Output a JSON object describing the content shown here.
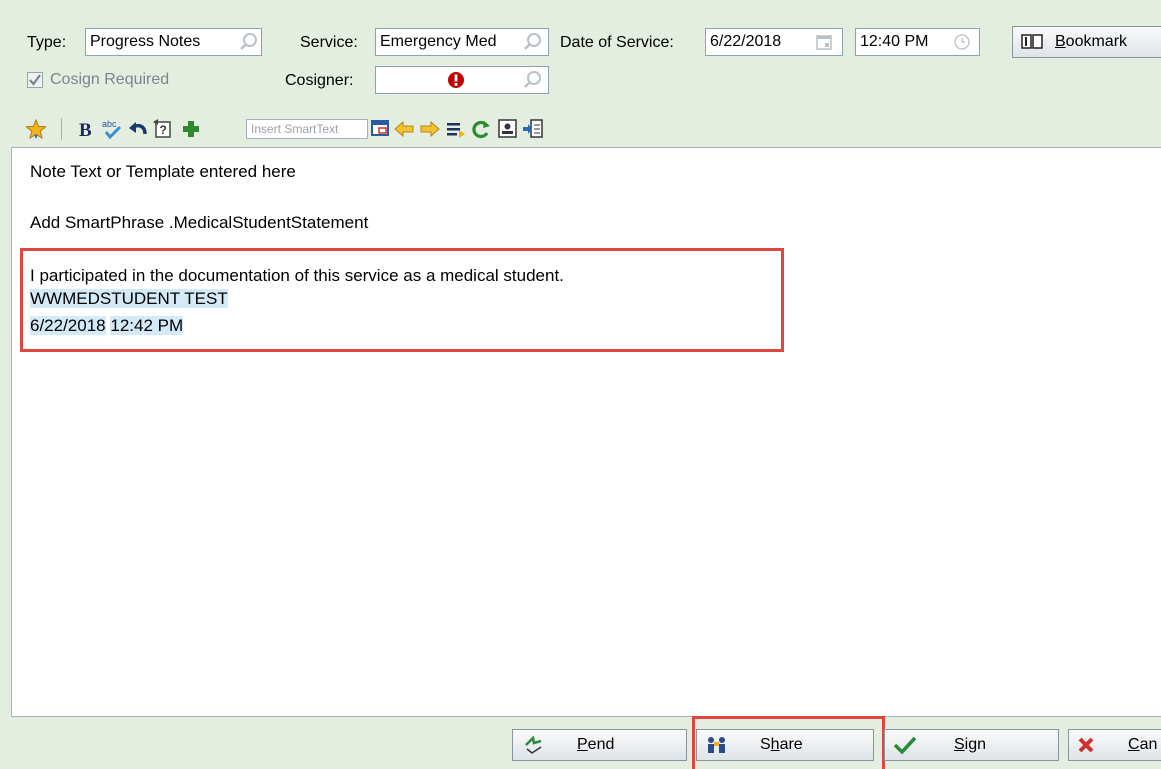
{
  "header": {
    "type_label": "Type:",
    "type_value": "Progress Notes",
    "service_label": "Service:",
    "service_value": "Emergency Med",
    "date_label": "Date of Service:",
    "date_value": "6/22/2018",
    "time_value": "12:40 PM",
    "bookmark_label_first": "B",
    "bookmark_label_rest": "ookmark",
    "cosign_required_label": "Cosign Required",
    "cosign_required_checked": true,
    "cosigner_label": "Cosigner:",
    "cosigner_value": ""
  },
  "toolbar": {
    "insert_smarttext_placeholder": "Insert SmartText",
    "icons": [
      "star-icon",
      "bold-icon",
      "spellcheck-icon",
      "undo-icon",
      "help-icon",
      "plus-icon",
      "insert-smarttext-icon",
      "arrow-left-icon",
      "arrow-right-icon",
      "list-icon",
      "refresh-icon",
      "portrait-icon",
      "import-icon"
    ]
  },
  "note": {
    "line1": "Note Text or Template entered here",
    "line2": "Add SmartPhrase .MedicalStudentStatement",
    "statement_line1": "I participated in the documentation of this service as a medical student.",
    "statement_line2": "WWMEDSTUDENT TEST",
    "statement_date": "6/22/2018",
    "statement_time": "12:42 PM"
  },
  "footer": {
    "pend_prefix": "",
    "pend_first": "P",
    "pend_rest": "end",
    "share_first": "S",
    "share_hot": "h",
    "share_rest": "are",
    "sign_first": "S",
    "sign_rest": "ign",
    "cancel_first": "C",
    "cancel_rest": "an"
  },
  "colors": {
    "background": "#e4eee0",
    "highlight_box": "#e0453f",
    "selection": "#d4eaf8",
    "error": "#c00000"
  }
}
